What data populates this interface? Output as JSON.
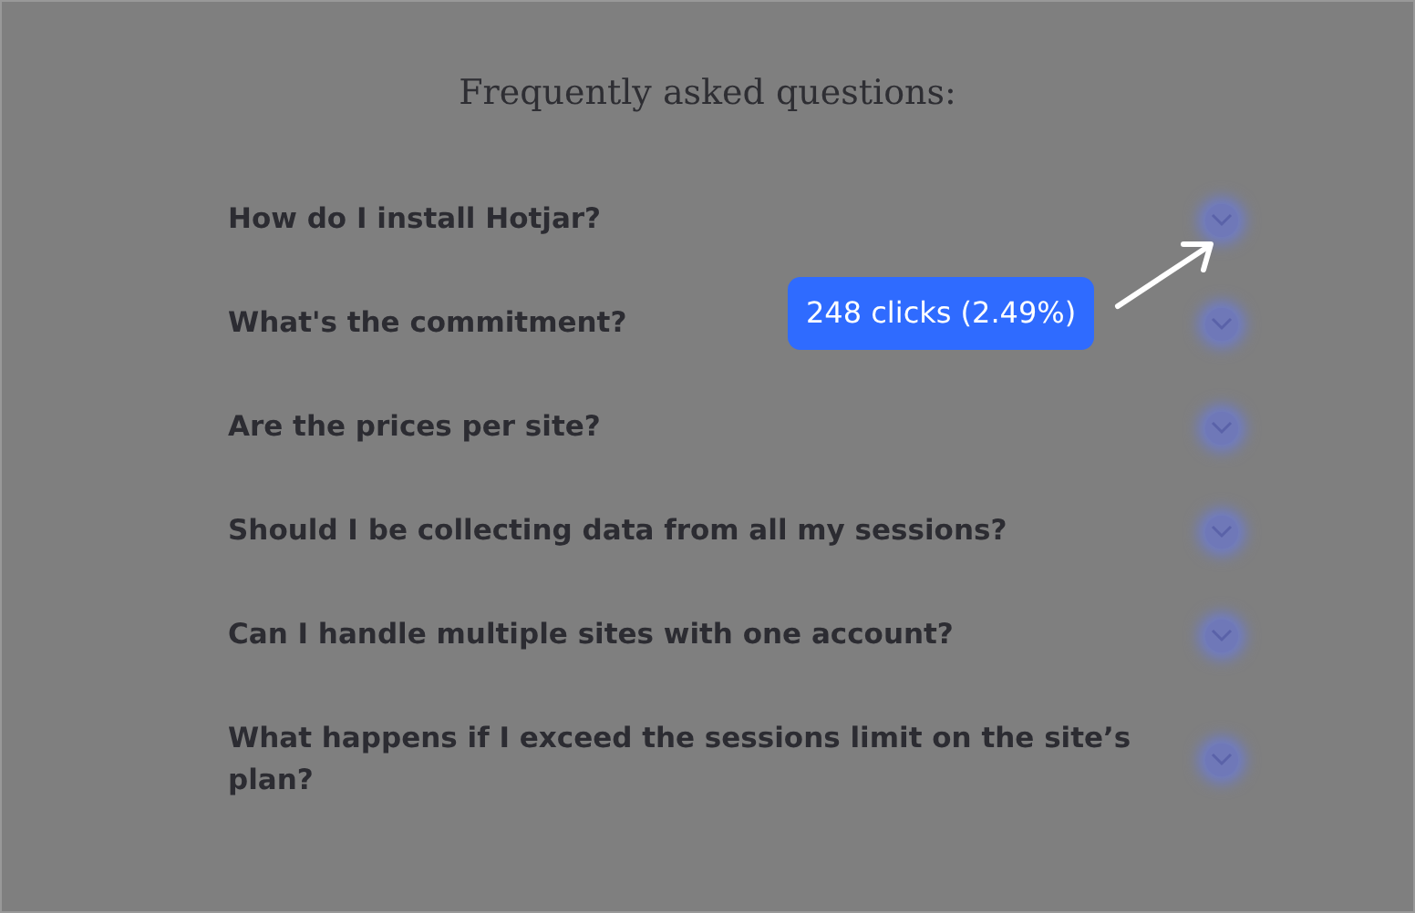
{
  "title": "Frequently asked questions:",
  "faq": [
    {
      "question": "How do I install Hotjar?"
    },
    {
      "question": "What's the commitment?"
    },
    {
      "question": "Are the prices per site?"
    },
    {
      "question": "Should I be collecting data from all my sessions?"
    },
    {
      "question": "Can I handle multiple sites with one account?"
    },
    {
      "question": "What happens if I exceed the sessions limit on the site’s plan?"
    }
  ],
  "click_callout": {
    "label": "248 clicks (2.49%)"
  }
}
